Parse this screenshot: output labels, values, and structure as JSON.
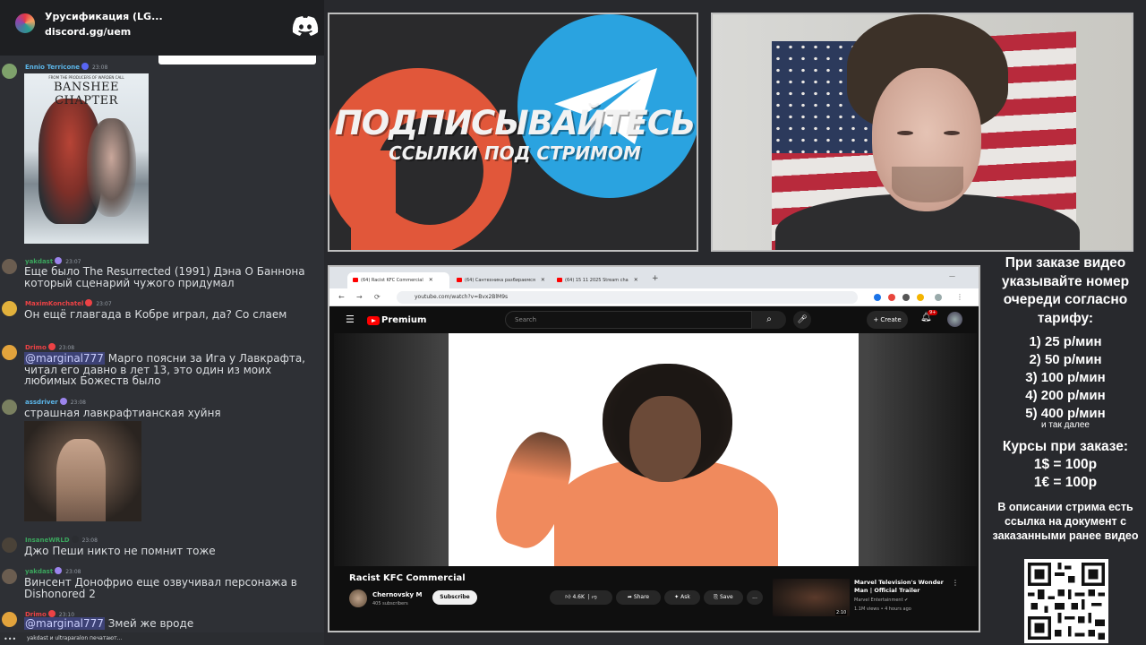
{
  "server": {
    "name": "Урусификация (LG...",
    "invite": "discord.gg/uem",
    "logo_icon": "discord-logo-icon"
  },
  "chat": {
    "messages": [
      {
        "user": "Ennio Terricone",
        "user_color": "#5bb5e8",
        "time": "23:08",
        "text": "",
        "attachment": "poster"
      },
      {
        "user": "yakdast",
        "user_color": "#3ba55d",
        "time": "23:07",
        "text": "Еще было The Resurrected (1991) Дэна О Баннона который сценарий чужого придумал"
      },
      {
        "user": "MaximKonchatel",
        "user_color": "#ed4245",
        "time": "23:07",
        "text": "Он ещё главгада в Кобре играл, да? Со слаем"
      },
      {
        "user": "Drimo",
        "user_color": "#ed4245",
        "time": "23:08",
        "mention": "@marginal777",
        "text": " Марго поясни за Ига у Лавкрафта, читал его давно в лет 13, это один из моих любимых Божеств было"
      },
      {
        "user": "assdriver",
        "user_color": "#5bb5e8",
        "time": "23:08",
        "text": "страшная лавкрафтианская хуйня",
        "attachment": "gif"
      },
      {
        "user": "InsaneWRLD",
        "user_color": "#3ba55d",
        "time": "23:08",
        "text": "Джо Пеши никто не помнит тоже"
      },
      {
        "user": "yakdast",
        "user_color": "#3ba55d",
        "time": "23:08",
        "text": "Винсент Донофрио еще озвучивал персонажа в Dishonored 2"
      },
      {
        "user": "Drimo",
        "user_color": "#ed4245",
        "time": "23:10",
        "mention": "@marginal777",
        "text": " Змей же вроде"
      }
    ],
    "typing": "yakdast и ultraparalon печатают...",
    "typing_dots": "•••"
  },
  "poster": {
    "tagline": "FROM THE PRODUCERS OF WARDEN CALL",
    "title": "BANSHEE CHAPTER"
  },
  "overlay": {
    "subscribe_title": "ПОДПИСЫВАЙТЕСЬ",
    "subscribe_sub": "ССЫЛКИ ПОД СТРИМОМ"
  },
  "browser": {
    "tabs": [
      {
        "label": "(64) Racist KFC Commercial",
        "active": true
      },
      {
        "label": "(64) Сантехника разбираемся",
        "active": false
      },
      {
        "label": "(64) 15 11 2025 Stream cha",
        "active": false
      }
    ],
    "new_tab": "+",
    "url": "youtube.com/watch?v=Bvx2BlM9s",
    "brand": "Premium",
    "search_placeholder": "Search",
    "create_label": "Create",
    "notif_count": "9+",
    "video_title": "Racist KFC Commercial",
    "channel": "Chernovsky M",
    "subs": "405 subscribers",
    "subscribe": "Subscribe",
    "likes": "4.6K",
    "share": "Share",
    "ask": "Ask",
    "save": "Save",
    "more": "...",
    "rec": {
      "title": "Marvel Television's Wonder Man | Official Trailer",
      "channel": "Marvel Entertainment",
      "meta": "1.1M views • 4 hours ago",
      "duration": "2:10"
    }
  },
  "info": {
    "order_text": "При заказе видео указывайте номер очереди согласно тарифу:",
    "prices": [
      "1) 25 р/мин",
      "2) 50 р/мин",
      "3) 100 р/мин",
      "4) 200 р/мин",
      "5) 400 р/мин"
    ],
    "and_so_on": "и так далее",
    "rates_title": "Курсы при заказе:",
    "rate_usd": "1$ = 100р",
    "rate_eur": "1€ = 100р",
    "doc_text": "В описании стрима есть ссылка на документ с заказанными ранее видео"
  },
  "colors": {
    "patreon": "#e1573a",
    "telegram": "#2aa3e0",
    "youtube_red": "#ff0000",
    "chat_bg": "#2e3035"
  }
}
